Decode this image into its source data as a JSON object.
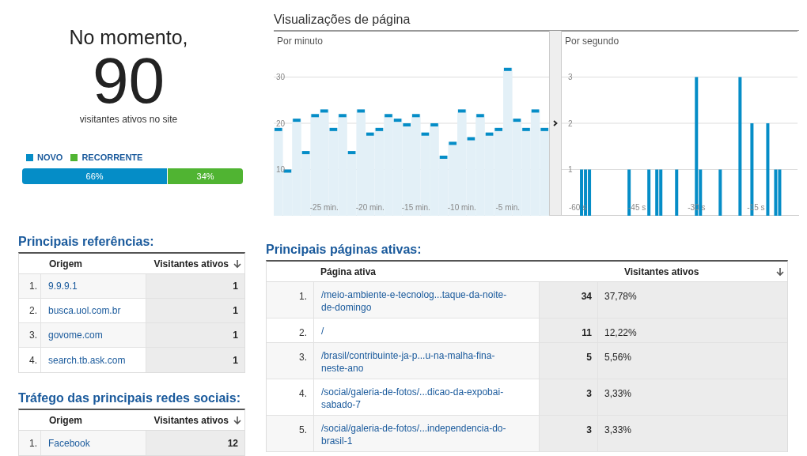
{
  "summary": {
    "heading": "No momento,",
    "count": "90",
    "caption": "visitantes ativos no site"
  },
  "visitor_types": [
    {
      "label": "NOVO",
      "color": "#058dc7",
      "share": "66%",
      "level": 0.66
    },
    {
      "label": "RECORRENTE",
      "color": "#50b432",
      "share": "34%",
      "level": 0.34
    }
  ],
  "pageviews": {
    "title": "Visualizações de página",
    "panels": [
      {
        "label": "Por minuto",
        "chart_data": {
          "type": "bar",
          "x": [
            -30,
            -29,
            -28,
            -27,
            -26,
            -25,
            -24,
            -23,
            -22,
            -21,
            -20,
            -19,
            -18,
            -17,
            -16,
            -15,
            -14,
            -13,
            -12,
            -11,
            -10,
            -9,
            -8,
            -7,
            -6,
            -5,
            -4,
            -3,
            -2,
            -1
          ],
          "values": [
            19,
            10,
            21,
            14,
            22,
            23,
            19,
            22,
            14,
            23,
            18,
            19,
            22,
            21,
            20,
            22,
            18,
            20,
            13,
            16,
            23,
            17,
            22,
            18,
            19,
            32,
            21,
            19,
            23,
            19
          ],
          "xlim": [
            -30.5,
            -0.5
          ],
          "ylim": [
            0,
            40
          ],
          "yticks": [
            10,
            20,
            30
          ],
          "grid": true,
          "xticks": [
            {
              "value": -25,
              "label": "-25 min."
            },
            {
              "value": -20,
              "label": "-20 min."
            },
            {
              "value": -15,
              "label": "-15 min."
            },
            {
              "value": -10,
              "label": "-10 min."
            },
            {
              "value": -5,
              "label": "-5 min."
            }
          ]
        }
      },
      {
        "label": "Por segundo",
        "chart_data": {
          "type": "bar",
          "x": [
            -59,
            -58,
            -57,
            -47,
            -42,
            -40,
            -39,
            -35,
            -30,
            -29,
            -24,
            -19,
            -16,
            -12,
            -10,
            -9
          ],
          "values": [
            1,
            1,
            1,
            1,
            1,
            1,
            1,
            1,
            3,
            1,
            1,
            3,
            2,
            2,
            1,
            1
          ],
          "xlim": [
            -64,
            -4.5
          ],
          "ylim": [
            0,
            4
          ],
          "yticks": [
            1,
            2,
            3
          ],
          "grid": true,
          "xticks": [
            {
              "value": -60,
              "label": "-60 s"
            },
            {
              "value": -45,
              "label": "-45 s"
            },
            {
              "value": -30,
              "label": "-30 s"
            },
            {
              "value": -15,
              "label": "-15 s"
            }
          ]
        }
      }
    ]
  },
  "referrals": {
    "title": "Principais referências:",
    "columns": [
      "Origem",
      "Visitantes ativos"
    ],
    "rows": [
      {
        "rank": "1.",
        "source": "9.9.9.1",
        "visitors": "1"
      },
      {
        "rank": "2.",
        "source": "busca.uol.com.br",
        "visitors": "1"
      },
      {
        "rank": "3.",
        "source": "govome.com",
        "visitors": "1"
      },
      {
        "rank": "4.",
        "source": "search.tb.ask.com",
        "visitors": "1"
      }
    ]
  },
  "social": {
    "title": "Tráfego das principais redes sociais:",
    "columns": [
      "Origem",
      "Visitantes ativos"
    ],
    "rows": [
      {
        "rank": "1.",
        "source": "Facebook",
        "visitors": "12"
      }
    ]
  },
  "active_pages": {
    "title": "Principais páginas ativas:",
    "columns": [
      "Página ativa",
      "Visitantes ativos"
    ],
    "rows": [
      {
        "rank": "1.",
        "page": "/meio-ambiente-e-tecnolog...taque-da-noite-de-domingo",
        "visitors": "34",
        "percent": "37,78%"
      },
      {
        "rank": "2.",
        "page": "/",
        "visitors": "11",
        "percent": "12,22%"
      },
      {
        "rank": "3.",
        "page": "/brasil/contribuinte-ja-p...u-na-malha-fina-neste-ano",
        "visitors": "5",
        "percent": "5,56%"
      },
      {
        "rank": "4.",
        "page": "/social/galeria-de-fotos/...dicao-da-expobai-sabado-7",
        "visitors": "3",
        "percent": "3,33%"
      },
      {
        "rank": "5.",
        "page": "/social/galeria-de-fotos/...independencia-do-brasil-1",
        "visitors": "3",
        "percent": "3,33%"
      }
    ]
  }
}
